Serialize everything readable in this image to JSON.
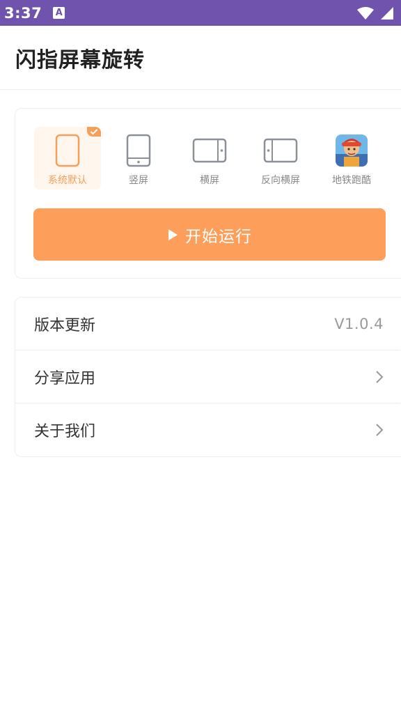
{
  "status_bar": {
    "time": "3:37",
    "notification_icon": "A",
    "icons": [
      "wifi-icon",
      "signal-icon"
    ],
    "background": "#6f53ad"
  },
  "header": {
    "title": "闪指屏幕旋转"
  },
  "modes": {
    "items": [
      {
        "label": "系统默认",
        "icon": "default-orientation-icon",
        "selected": true
      },
      {
        "label": "竖屏",
        "icon": "portrait-icon",
        "selected": false
      },
      {
        "label": "横屏",
        "icon": "landscape-icon",
        "selected": false
      },
      {
        "label": "反向横屏",
        "icon": "reverse-landscape-icon",
        "selected": false
      },
      {
        "label": "地铁跑酷",
        "icon": "subway-surfers-app-icon",
        "selected": false
      }
    ],
    "accent": "#f5a05a"
  },
  "run_button": {
    "label": "开始运行",
    "color": "#fd9e5a"
  },
  "menu": {
    "items": [
      {
        "label": "版本更新",
        "value": "V1.0.4"
      },
      {
        "label": "分享应用",
        "icon": "chevron-right-icon"
      },
      {
        "label": "关于我们",
        "icon": "chevron-right-icon"
      }
    ]
  }
}
